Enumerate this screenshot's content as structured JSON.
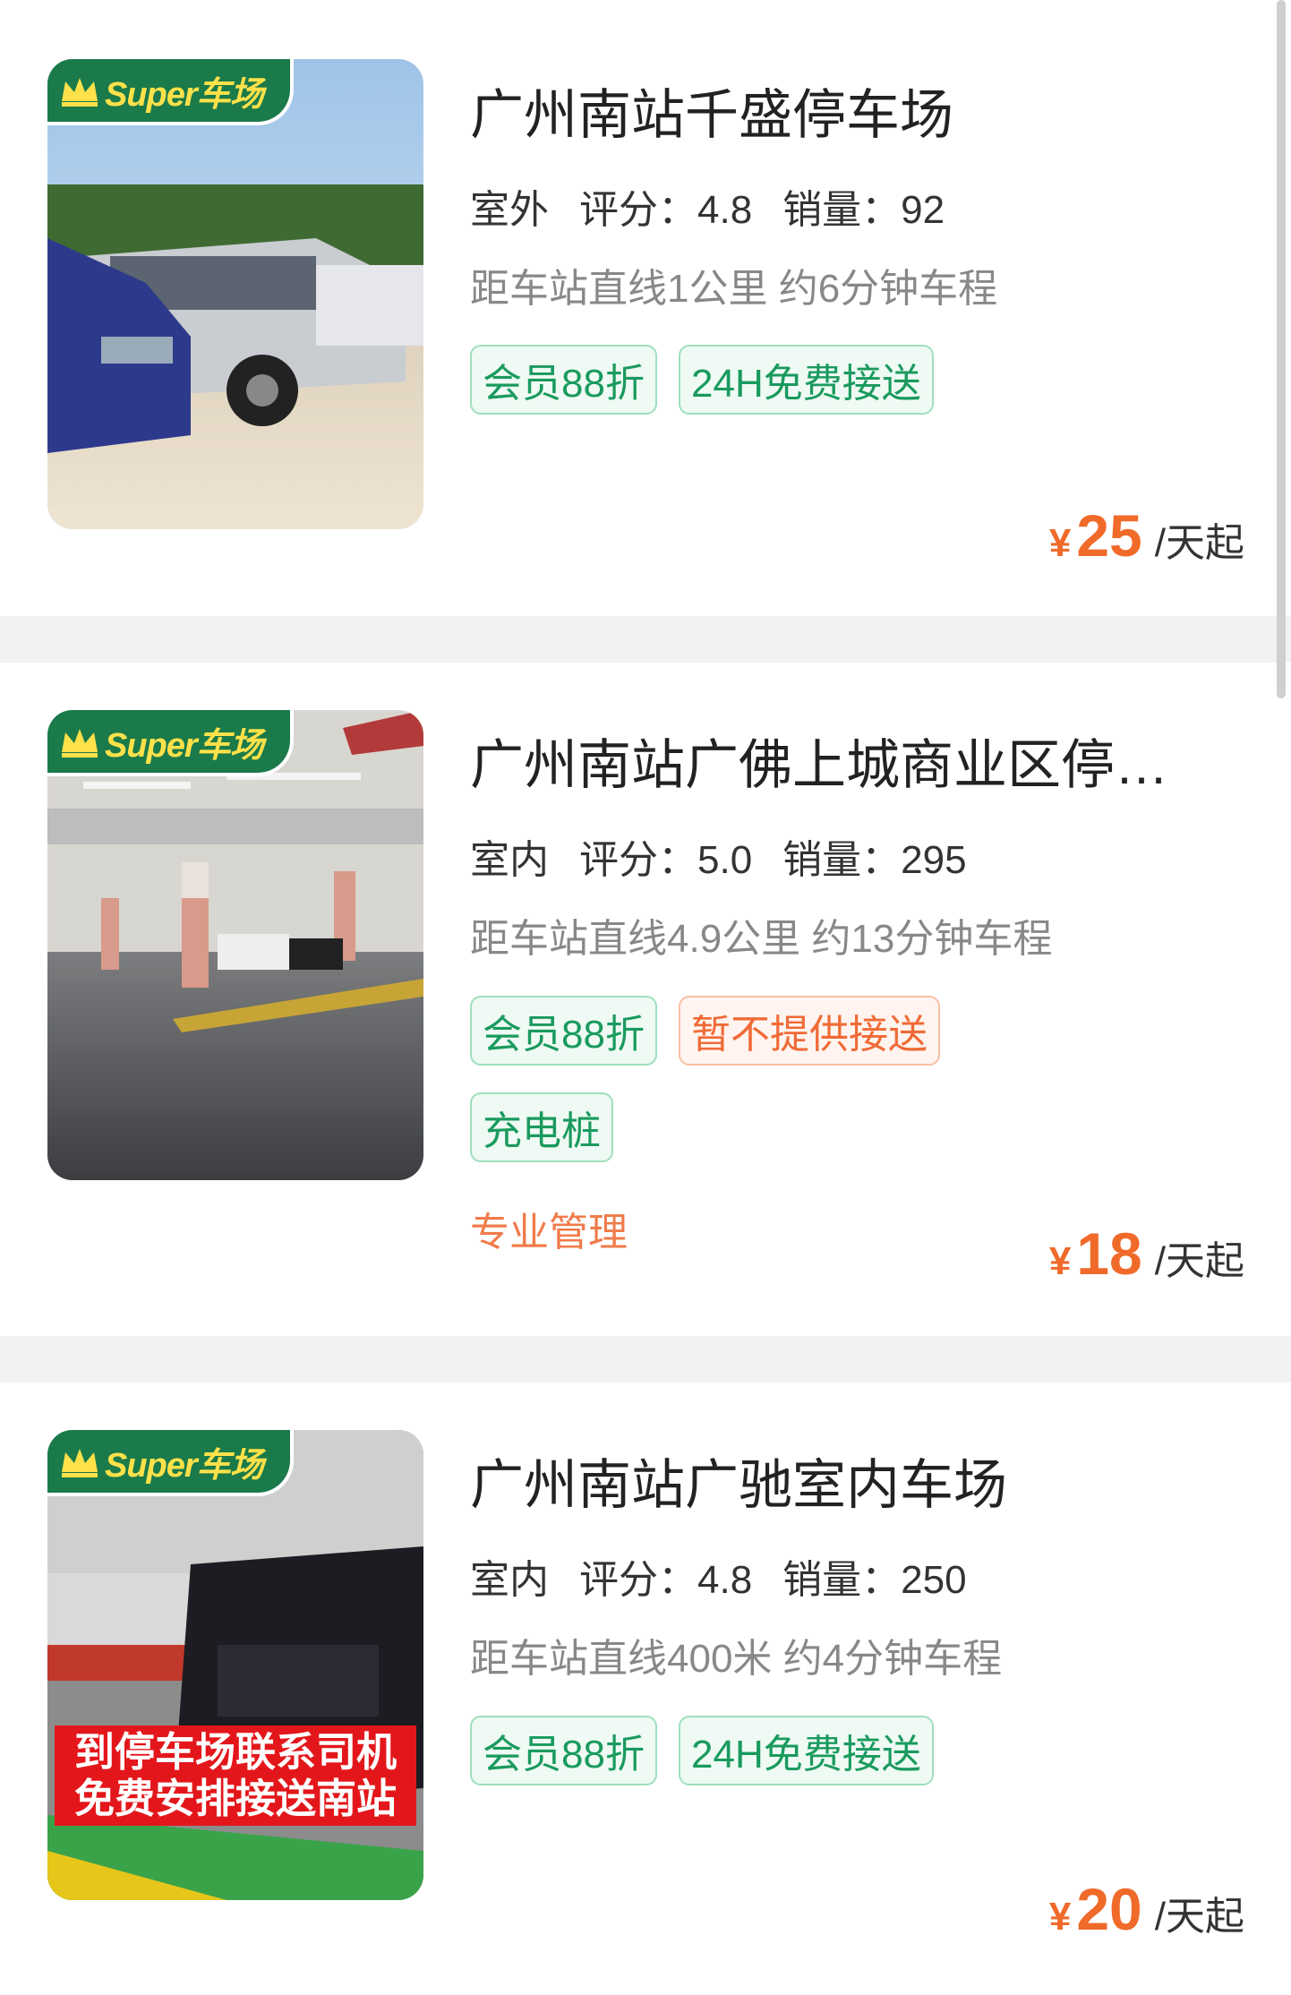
{
  "badge_text": "Super车场",
  "listings": [
    {
      "title": "广州南站千盛停车场",
      "kind": "室外",
      "rating_label": "评分：",
      "rating": "4.8",
      "sales_label": "销量：",
      "sales": "92",
      "distance": "距车站直线1公里 约6分钟车程",
      "tags": [
        {
          "text": "会员88折",
          "style": "green"
        },
        {
          "text": "24H免费接送",
          "style": "green"
        }
      ],
      "extra_tags": [],
      "note": "",
      "currency": "¥",
      "price": "25",
      "unit": "/天起"
    },
    {
      "title": "广州南站广佛上城商业区停车场",
      "kind": "室内",
      "rating_label": "评分：",
      "rating": "5.0",
      "sales_label": "销量：",
      "sales": "295",
      "distance": "距车站直线4.9公里 约13分钟车程",
      "tags": [
        {
          "text": "会员88折",
          "style": "green"
        },
        {
          "text": "暂不提供接送",
          "style": "orange"
        }
      ],
      "extra_tags": [
        {
          "text": "充电桩",
          "style": "green"
        }
      ],
      "note": "专业管理",
      "currency": "¥",
      "price": "18",
      "unit": "/天起"
    },
    {
      "title": "广州南站广驰室内车场",
      "kind": "室内",
      "rating_label": "评分：",
      "rating": "4.8",
      "sales_label": "销量：",
      "sales": "250",
      "distance": "距车站直线400米 约4分钟车程",
      "tags": [
        {
          "text": "会员88折",
          "style": "green"
        },
        {
          "text": "24H免费接送",
          "style": "green"
        }
      ],
      "extra_tags": [],
      "note": "",
      "photo_caption_line1": "到停车场联系司机",
      "photo_caption_line2": "免费安排接送南站",
      "currency": "¥",
      "price": "20",
      "unit": "/天起"
    }
  ],
  "colors": {
    "accent_green": "#1a9a5e",
    "badge_green": "#1a7a49",
    "price_orange": "#f06a2a",
    "separator": "#f2f2f2"
  }
}
